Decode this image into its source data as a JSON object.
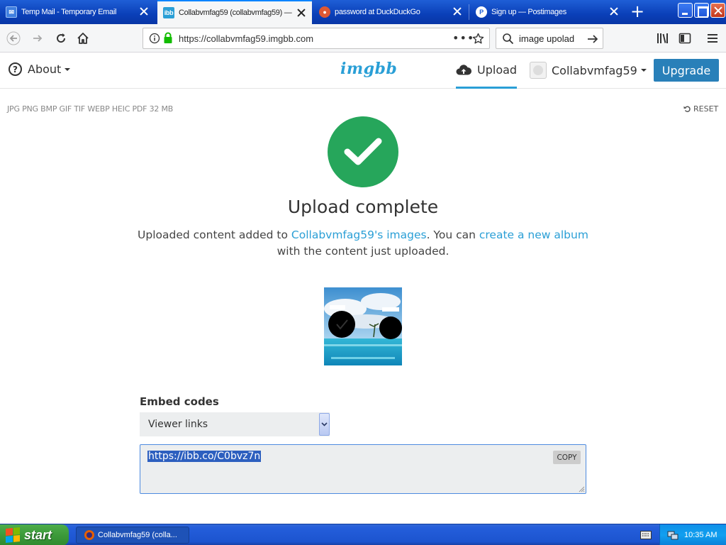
{
  "browser": {
    "tabs": [
      {
        "label": "Temp Mail - Temporary Email",
        "favicon": "mail-icon",
        "active": false
      },
      {
        "label": "Collabvmfag59 (collabvmfag59) — ",
        "favicon": "imgbb-icon",
        "favicon_text": "ibb",
        "active": true
      },
      {
        "label": "password at DuckDuckGo",
        "favicon": "duckduckgo-icon",
        "active": false
      },
      {
        "label": "Sign up — Postimages",
        "favicon": "postimages-icon",
        "favicon_text": "P",
        "active": false
      }
    ],
    "url": "https://collabvmfag59.imgbb.com",
    "search_value": "image upolad"
  },
  "header": {
    "about_label": "About",
    "logo_text": "imgbb",
    "upload_label": "Upload",
    "username": "Collabvmfag59",
    "upgrade_label": "Upgrade"
  },
  "main": {
    "formats_text": "JPG PNG BMP GIF TIF WEBP HEIC PDF  32 MB",
    "reset_label": "RESET",
    "title": "Upload complete",
    "desc_part1": "Uploaded content added to ",
    "desc_link1": "Collabvmfag59's images",
    "desc_part2": ". You can ",
    "desc_link2": "create a new album",
    "desc_part3": " with the content just uploaded.",
    "embed_label": "Embed codes",
    "embed_selected": "Viewer links",
    "embed_code": "https://ibb.co/C0bvz7n",
    "copy_label": "COPY"
  },
  "taskbar": {
    "start_label": "start",
    "task_label": "Collabvmfag59 (colla...",
    "clock": "10:35 AM"
  },
  "colors": {
    "accent": "#2a9fd6",
    "success": "#26a65b",
    "upgrade": "#2980b9"
  }
}
